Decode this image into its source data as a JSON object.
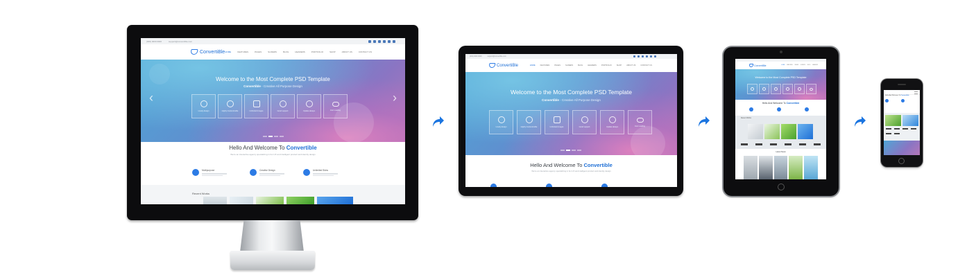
{
  "site": {
    "phone": "(000) 0000 0000",
    "email": "support@convertible.com",
    "logo": "ConvertiBle",
    "menu": [
      "HOME",
      "FEATURES",
      "PAGES",
      "SLIDERS",
      "BLOG",
      "HEADERS",
      "PORTFOLIO",
      "SHOP",
      "ABOUT US",
      "CONTACT US"
    ],
    "hero_title": "Welcome to the Most Complete PSD Template",
    "hero_sub_brand": "Convertible",
    "hero_sub_rest": " - Creative All Purpose Design",
    "features": [
      "Lovely design",
      "Highly Customizable",
      "Unlimited images",
      "Good support",
      "Update always",
      "Icon Loading"
    ],
    "welcome_prefix": "Hello And Welcome To ",
    "welcome_brand": "Convertible",
    "welcome_sub": "We're an interactive agency specializing in fun UX and intelligent product and identity design",
    "services": [
      "Multipurpose",
      "Creative Design",
      "Unlimited Skins"
    ],
    "recent_works": "Recent Works",
    "latest_news": "Latest News",
    "arrow_left": "‹",
    "arrow_right": "›"
  },
  "devices": [
    "desktop-monitor",
    "laptop-tablet-landscape",
    "tablet-portrait",
    "smartphone"
  ],
  "colors": {
    "accent": "#1e6fd6",
    "arrow": "#1b75e0",
    "device": "#0d0d0f"
  }
}
